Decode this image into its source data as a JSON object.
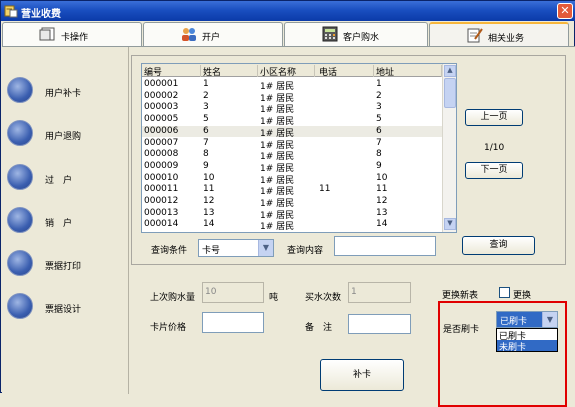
{
  "window": {
    "title": "营业收费",
    "close": "✕"
  },
  "tabs": [
    {
      "label": "卡操作"
    },
    {
      "label": "开户"
    },
    {
      "label": "客户购水"
    },
    {
      "label": "相关业务"
    }
  ],
  "sidebar": {
    "items": [
      {
        "label": "用户补卡"
      },
      {
        "label": "用户退购"
      },
      {
        "label": "过　户"
      },
      {
        "label": "销　户"
      },
      {
        "label": "票据打印"
      },
      {
        "label": "票据设计"
      }
    ]
  },
  "grid": {
    "columns": [
      "编号",
      "姓名",
      "小区名称",
      "电话",
      "地址"
    ],
    "rows": [
      [
        "000001",
        "1",
        "1# 居民",
        "",
        "1"
      ],
      [
        "000002",
        "2",
        "1# 居民",
        "",
        "2"
      ],
      [
        "000003",
        "3",
        "1# 居民",
        "",
        "3"
      ],
      [
        "000005",
        "5",
        "1# 居民",
        "",
        "5"
      ],
      [
        "000006",
        "6",
        "1# 居民",
        "",
        "6"
      ],
      [
        "000007",
        "7",
        "1# 居民",
        "",
        "7"
      ],
      [
        "000008",
        "8",
        "1# 居民",
        "",
        "8"
      ],
      [
        "000009",
        "9",
        "1# 居民",
        "",
        "9"
      ],
      [
        "000010",
        "10",
        "1# 居民",
        "",
        "10"
      ],
      [
        "000011",
        "11",
        "1# 居民",
        "11",
        "11"
      ],
      [
        "000012",
        "12",
        "1# 居民",
        "",
        "12"
      ],
      [
        "000013",
        "13",
        "1# 居民",
        "",
        "13"
      ],
      [
        "000014",
        "14",
        "1# 居民",
        "",
        "14"
      ]
    ]
  },
  "pager": {
    "prev": "上一页",
    "page": "1/10",
    "next": "下一页"
  },
  "query": {
    "condition_label": "查询条件",
    "condition_value": "卡号",
    "content_label": "查询内容",
    "content_value": "",
    "button": "查询"
  },
  "form": {
    "last_purchase_label": "上次购水量",
    "last_purchase_value": "10",
    "last_purchase_unit": "吨",
    "buy_count_label": "买水次数",
    "buy_count_value": "1",
    "change_meter_label": "更换新表",
    "change_label": "更换",
    "card_price_label": "卡片价格",
    "card_price_value": "",
    "remark_label": "备　注",
    "remark_value": "",
    "swiped_label": "是否刷卡",
    "swiped_value": "已刷卡",
    "swiped_options": [
      "已刷卡",
      "未刷卡"
    ],
    "submit": "补卡"
  }
}
